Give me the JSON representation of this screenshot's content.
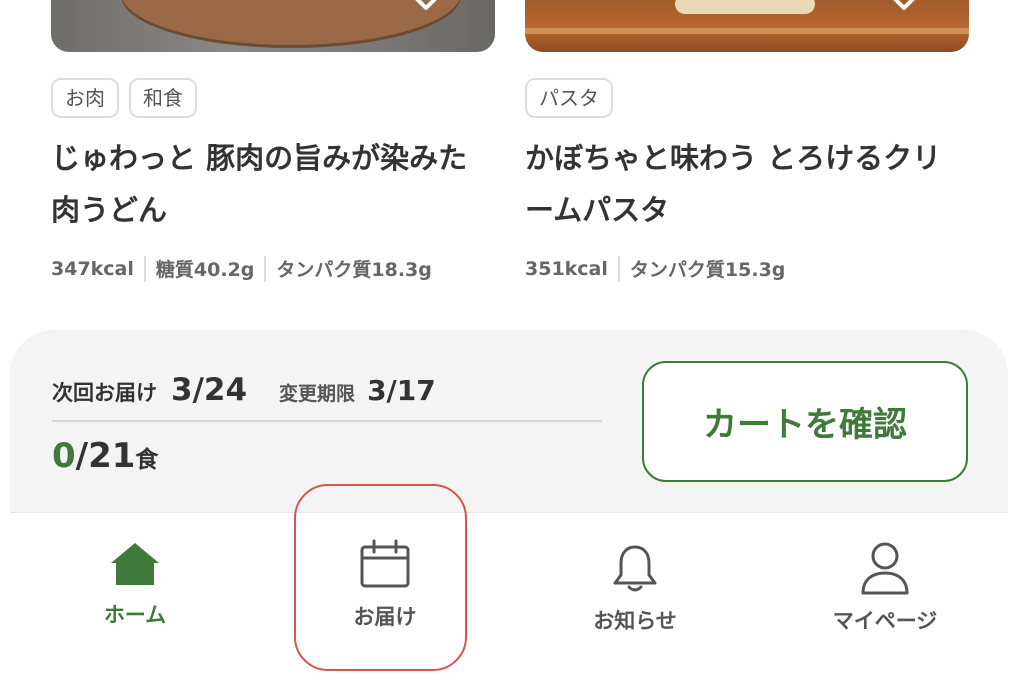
{
  "recipes": [
    {
      "tags": [
        "お肉",
        "和食"
      ],
      "title": "じゅわっと 豚肉の旨みが染みた肉うどん",
      "nutrition": [
        "347kcal",
        "糖質40.2g",
        "タンパク質18.3g"
      ]
    },
    {
      "tags": [
        "パスタ"
      ],
      "title": "かぼちゃと味わう とろけるクリームパスタ",
      "nutrition": [
        "351kcal",
        "タンパク質15.3g"
      ]
    }
  ],
  "delivery": {
    "next_label": "次回お届け",
    "next_date": "3/24",
    "deadline_label": "変更期限",
    "deadline_date": "3/17",
    "count_current": "0",
    "count_total": "/21",
    "count_unit": "食",
    "cart_button": "カートを確認"
  },
  "nav": {
    "items": [
      {
        "label": "ホーム",
        "icon": "home-icon",
        "active": true
      },
      {
        "label": "お届け",
        "icon": "calendar-icon",
        "active": false
      },
      {
        "label": "お知らせ",
        "icon": "bell-icon",
        "active": false
      },
      {
        "label": "マイページ",
        "icon": "user-icon",
        "active": false
      }
    ]
  },
  "colors": {
    "accent": "#3f7a3a",
    "highlight": "#d9534f",
    "panel_bg": "#f4f4f4"
  }
}
